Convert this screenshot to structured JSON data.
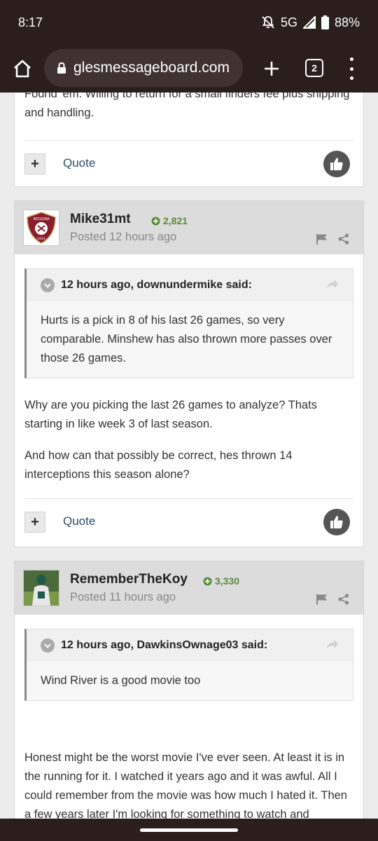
{
  "status": {
    "time": "8:17",
    "network": "5G",
    "battery": "88%"
  },
  "browser": {
    "url": "glesmessageboard.com",
    "tab_count": "2"
  },
  "post0": {
    "text": "Found 'em. Willing to return for a small finders fee plus shipping and handling.",
    "quote_label": "Quote"
  },
  "post1": {
    "author": "Mike31mt",
    "reputation": "2,821",
    "posted": "Posted 12 hours ago",
    "avatar_text": "REGGINA",
    "avatar_year": "1914",
    "quote": {
      "header": "12 hours ago, downundermike said:",
      "body": "Hurts is a pick in 8 of his last 26 games, so very comparable.  Minshew has also thrown more passes over those 26 games."
    },
    "paragraphs": [
      "Why are you picking the last 26 games to analyze?  Thats starting in like week 3 of last season.",
      "And how can that possibly be correct, hes thrown 14 interceptions this season alone?"
    ],
    "quote_label": "Quote"
  },
  "post2": {
    "author": "RememberTheKoy",
    "reputation": "3,330",
    "posted": "Posted 11 hours ago",
    "quote": {
      "header": "12 hours ago, DawkinsOwnage03 said:",
      "body": "Wind River is a good movie too"
    },
    "paragraph": "Honest might be the worst movie I've ever seen.  At least it is in the running for it.  I watched it years ago and it was awful.  All I could remember from the movie was how much I hated it.  Then a few years later I'm looking for something to watch and"
  },
  "colors": {
    "chrome": "#2a1f1d",
    "rep_green": "#5a8a3a",
    "link": "#2d4d6a"
  }
}
